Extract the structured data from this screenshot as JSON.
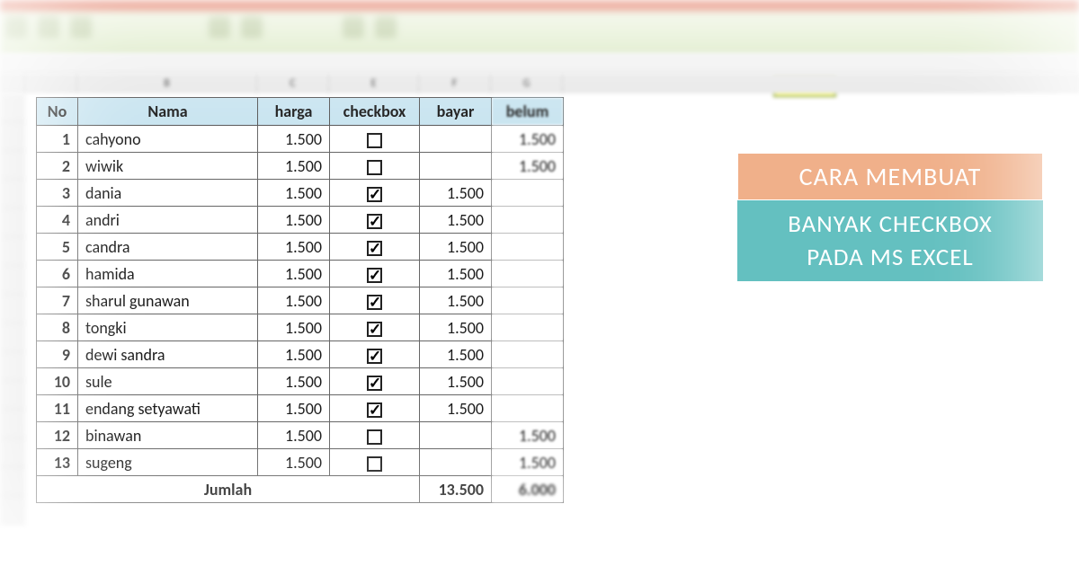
{
  "columns_letters": [
    "B",
    "C",
    "E",
    "F",
    "G"
  ],
  "headers": {
    "no": "No",
    "nama": "Nama",
    "harga": "harga",
    "checkbox": "checkbox",
    "bayar": "bayar",
    "belum": "belum"
  },
  "rows": [
    {
      "no": "1",
      "nama": "cahyono",
      "harga": "1.500",
      "checked": false,
      "bayar": "",
      "belum": "1.500"
    },
    {
      "no": "2",
      "nama": "wiwik",
      "harga": "1.500",
      "checked": false,
      "bayar": "",
      "belum": "1.500"
    },
    {
      "no": "3",
      "nama": "dania",
      "harga": "1.500",
      "checked": true,
      "bayar": "1.500",
      "belum": ""
    },
    {
      "no": "4",
      "nama": "andri",
      "harga": "1.500",
      "checked": true,
      "bayar": "1.500",
      "belum": ""
    },
    {
      "no": "5",
      "nama": "candra",
      "harga": "1.500",
      "checked": true,
      "bayar": "1.500",
      "belum": ""
    },
    {
      "no": "6",
      "nama": "hamida",
      "harga": "1.500",
      "checked": true,
      "bayar": "1.500",
      "belum": ""
    },
    {
      "no": "7",
      "nama": "sharul gunawan",
      "harga": "1.500",
      "checked": true,
      "bayar": "1.500",
      "belum": ""
    },
    {
      "no": "8",
      "nama": "tongki",
      "harga": "1.500",
      "checked": true,
      "bayar": "1.500",
      "belum": ""
    },
    {
      "no": "9",
      "nama": "dewi sandra",
      "harga": "1.500",
      "checked": true,
      "bayar": "1.500",
      "belum": ""
    },
    {
      "no": "10",
      "nama": "sule",
      "harga": "1.500",
      "checked": true,
      "bayar": "1.500",
      "belum": ""
    },
    {
      "no": "11",
      "nama": "endang setyawati",
      "harga": "1.500",
      "checked": true,
      "bayar": "1.500",
      "belum": ""
    },
    {
      "no": "12",
      "nama": "binawan",
      "harga": "1.500",
      "checked": false,
      "bayar": "",
      "belum": "1.500"
    },
    {
      "no": "13",
      "nama": "sugeng",
      "harga": "1.500",
      "checked": false,
      "bayar": "",
      "belum": "1.500"
    }
  ],
  "total": {
    "label": "Jumlah",
    "bayar": "13.500",
    "belum": "6.000"
  },
  "caption": {
    "line1": "CARA MEMBUAT",
    "line2": "BANYAK CHECKBOX",
    "line3": "PADA MS EXCEL"
  }
}
